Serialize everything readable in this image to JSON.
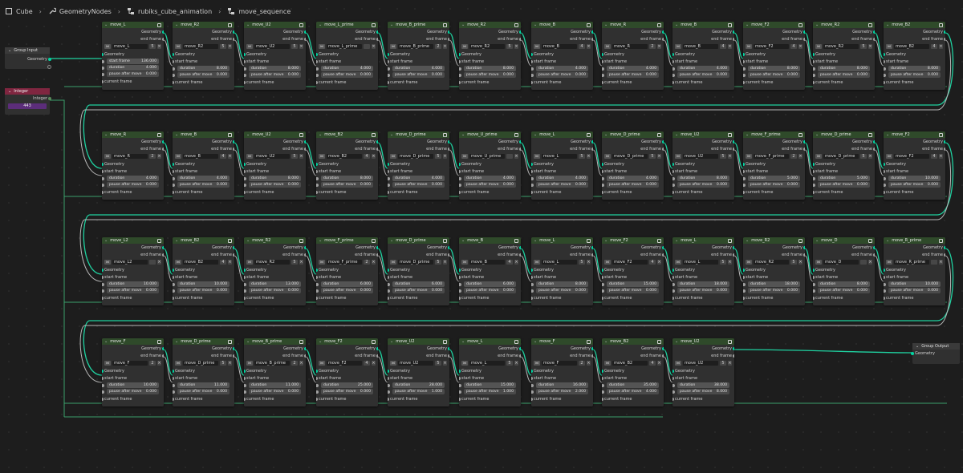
{
  "breadcrumb": {
    "items": [
      {
        "label": "Cube",
        "icon": "object-icon"
      },
      {
        "label": "GeometryNodes",
        "icon": "wrench-icon"
      },
      {
        "label": "rubiks_cube_animation",
        "icon": "node-tree-icon"
      },
      {
        "label": "move_sequence",
        "icon": "node-group-icon"
      }
    ]
  },
  "labels": {
    "geometry": "Geometry",
    "end_frame": "end frame",
    "start_frame": "start frame",
    "duration": "duration",
    "pause": "pause after move",
    "current_frame": "current frame",
    "integer": "Integer"
  },
  "group_input": {
    "title": "Group Input",
    "socket": "Geometry"
  },
  "group_output": {
    "title": "Group Output",
    "socket": "Geometry"
  },
  "integer_node": {
    "title": "Integer",
    "output": "Integer",
    "value": "443"
  },
  "colors": {
    "geometry_socket": "#00d6a3",
    "value_socket": "#a1a1a1",
    "node_header": "#2f4a2a",
    "integer_header": "#802640",
    "integer_value": "#5c2d7a"
  },
  "rows": [
    [
      {
        "title": "move_L",
        "group": "move_L",
        "users": "5",
        "start": "136.000",
        "duration": "4.000",
        "pause": "0.000"
      },
      {
        "title": "move_R2",
        "group": "move_R2",
        "users": "5",
        "start": "",
        "duration": "8.000",
        "pause": "0.000"
      },
      {
        "title": "move_U2",
        "group": "move_U2",
        "users": "5",
        "start": "",
        "duration": "8.000",
        "pause": "0.000"
      },
      {
        "title": "move_L_prime",
        "group": "move_L_prime",
        "users": "",
        "start": "",
        "duration": "4.000",
        "pause": "0.000"
      },
      {
        "title": "move_B_prime",
        "group": "move_B_prime",
        "users": "2",
        "start": "",
        "duration": "4.000",
        "pause": "0.000"
      },
      {
        "title": "move_R2",
        "group": "move_R2",
        "users": "5",
        "start": "",
        "duration": "8.000",
        "pause": "0.000"
      },
      {
        "title": "move_B",
        "group": "move_B",
        "users": "4",
        "start": "",
        "duration": "4.000",
        "pause": "0.000"
      },
      {
        "title": "move_R",
        "group": "move_R",
        "users": "2",
        "start": "",
        "duration": "4.000",
        "pause": "0.000"
      },
      {
        "title": "move_B",
        "group": "move_B",
        "users": "4",
        "start": "",
        "duration": "4.000",
        "pause": "0.000"
      },
      {
        "title": "move_F2",
        "group": "move_F2",
        "users": "4",
        "start": "",
        "duration": "8.000",
        "pause": "0.000"
      },
      {
        "title": "move_R2",
        "group": "move_R2",
        "users": "5",
        "start": "",
        "duration": "8.000",
        "pause": "0.000"
      },
      {
        "title": "move_B2",
        "group": "move_B2",
        "users": "4",
        "start": "",
        "duration": "8.000",
        "pause": "0.000"
      }
    ],
    [
      {
        "title": "move_R",
        "group": "move_R",
        "users": "2",
        "start": "",
        "duration": "4.000",
        "pause": "0.000"
      },
      {
        "title": "move_B",
        "group": "move_B",
        "users": "4",
        "start": "",
        "duration": "4.000",
        "pause": "0.000"
      },
      {
        "title": "move_U2",
        "group": "move_U2",
        "users": "5",
        "start": "",
        "duration": "8.000",
        "pause": "0.000"
      },
      {
        "title": "move_B2",
        "group": "move_B2",
        "users": "4",
        "start": "",
        "duration": "8.000",
        "pause": "0.000"
      },
      {
        "title": "move_D_prime",
        "group": "move_D_prime",
        "users": "5",
        "start": "",
        "duration": "4.000",
        "pause": "0.000"
      },
      {
        "title": "move_U_prime",
        "group": "move_U_prime",
        "users": "",
        "start": "",
        "duration": "4.000",
        "pause": "0.000"
      },
      {
        "title": "move_L",
        "group": "move_L",
        "users": "5",
        "start": "",
        "duration": "4.000",
        "pause": "0.000"
      },
      {
        "title": "move_D_prime",
        "group": "move_D_prime",
        "users": "5",
        "start": "",
        "duration": "4.000",
        "pause": "0.000"
      },
      {
        "title": "move_U2",
        "group": "move_U2",
        "users": "5",
        "start": "",
        "duration": "8.000",
        "pause": "0.000"
      },
      {
        "title": "move_F_prime",
        "group": "move_F_prime",
        "users": "2",
        "start": "",
        "duration": "5.000",
        "pause": "0.000"
      },
      {
        "title": "move_D_prime",
        "group": "move_D_prime",
        "users": "5",
        "start": "",
        "duration": "5.000",
        "pause": "0.000"
      },
      {
        "title": "move_F2",
        "group": "move_F2",
        "users": "4",
        "start": "",
        "duration": "10.000",
        "pause": "0.000"
      }
    ],
    [
      {
        "title": "move_L2",
        "group": "move_L2",
        "users": "",
        "start": "",
        "duration": "10.000",
        "pause": "0.000"
      },
      {
        "title": "move_B2",
        "group": "move_B2",
        "users": "4",
        "start": "",
        "duration": "10.000",
        "pause": "0.000"
      },
      {
        "title": "move_R2",
        "group": "move_R2",
        "users": "5",
        "start": "",
        "duration": "13.000",
        "pause": "0.000"
      },
      {
        "title": "move_F_prime",
        "group": "move_F_prime",
        "users": "2",
        "start": "",
        "duration": "6.000",
        "pause": "0.000"
      },
      {
        "title": "move_D_prime",
        "group": "move_D_prime",
        "users": "5",
        "start": "",
        "duration": "6.000",
        "pause": "0.000"
      },
      {
        "title": "move_B",
        "group": "move_B",
        "users": "4",
        "start": "",
        "duration": "6.000",
        "pause": "0.000"
      },
      {
        "title": "move_L",
        "group": "move_L",
        "users": "5",
        "start": "",
        "duration": "8.000",
        "pause": "0.000"
      },
      {
        "title": "move_F2",
        "group": "move_F2",
        "users": "4",
        "start": "",
        "duration": "15.000",
        "pause": "0.000"
      },
      {
        "title": "move_L",
        "group": "move_L",
        "users": "5",
        "start": "",
        "duration": "18.000",
        "pause": "0.000"
      },
      {
        "title": "move_R2",
        "group": "move_R2",
        "users": "5",
        "start": "",
        "duration": "18.000",
        "pause": "0.000"
      },
      {
        "title": "move_D",
        "group": "move_D",
        "users": "",
        "start": "",
        "duration": "8.000",
        "pause": "0.000"
      },
      {
        "title": "move_R_prime",
        "group": "move_R_prime",
        "users": "",
        "start": "",
        "duration": "10.000",
        "pause": "0.000"
      }
    ],
    [
      {
        "title": "move_F",
        "group": "move_F",
        "users": "2",
        "start": "",
        "duration": "10.000",
        "pause": "0.000"
      },
      {
        "title": "move_D_prime",
        "group": "move_D_prime",
        "users": "5",
        "start": "",
        "duration": "11.000",
        "pause": "0.000"
      },
      {
        "title": "move_B_prime",
        "group": "move_B_prime",
        "users": "2",
        "start": "",
        "duration": "11.000",
        "pause": "0.000"
      },
      {
        "title": "move_F2",
        "group": "move_F2",
        "users": "4",
        "start": "",
        "duration": "25.000",
        "pause": "0.000"
      },
      {
        "title": "move_U2",
        "group": "move_U2",
        "users": "5",
        "start": "",
        "duration": "28.000",
        "pause": "1.000"
      },
      {
        "title": "move_L",
        "group": "move_L",
        "users": "5",
        "start": "",
        "duration": "15.000",
        "pause": "1.000"
      },
      {
        "title": "move_F",
        "group": "move_F",
        "users": "2",
        "start": "",
        "duration": "16.000",
        "pause": "2.000"
      },
      {
        "title": "move_B2",
        "group": "move_B2",
        "users": "4",
        "start": "",
        "duration": "35.000",
        "pause": "4.000"
      },
      {
        "title": "move_U2",
        "group": "move_U2",
        "users": "5",
        "start": "",
        "duration": "38.000",
        "pause": "8.000"
      }
    ]
  ]
}
